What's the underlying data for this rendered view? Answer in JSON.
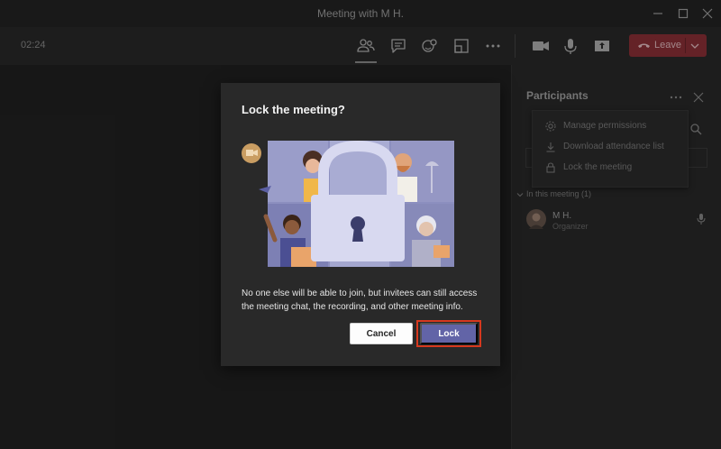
{
  "window": {
    "title": "Meeting with M H."
  },
  "toolbar": {
    "timer": "02:24",
    "leave_label": "Leave",
    "buttons": [
      "participants-icon",
      "chat-icon",
      "reactions-icon",
      "rooms-icon",
      "more-icon",
      "camera-icon",
      "mic-icon",
      "share-icon"
    ]
  },
  "panel": {
    "title": "Participants",
    "menu": [
      {
        "label": "Manage permissions",
        "icon": "gear-icon"
      },
      {
        "label": "Download attendance list",
        "icon": "download-icon"
      },
      {
        "label": "Lock the meeting",
        "icon": "lock-icon"
      }
    ],
    "section": "In this meeting (1)",
    "participant": {
      "name": "M H.",
      "role": "Organizer"
    }
  },
  "dialog": {
    "title": "Lock the meeting?",
    "body": "No one else will be able to join, but invitees can still access the meeting chat, the recording, and other meeting info.",
    "cancel_label": "Cancel",
    "lock_label": "Lock"
  },
  "colors": {
    "accent": "#6264a7",
    "leave": "#7a2a30",
    "highlight": "#d7381e"
  }
}
